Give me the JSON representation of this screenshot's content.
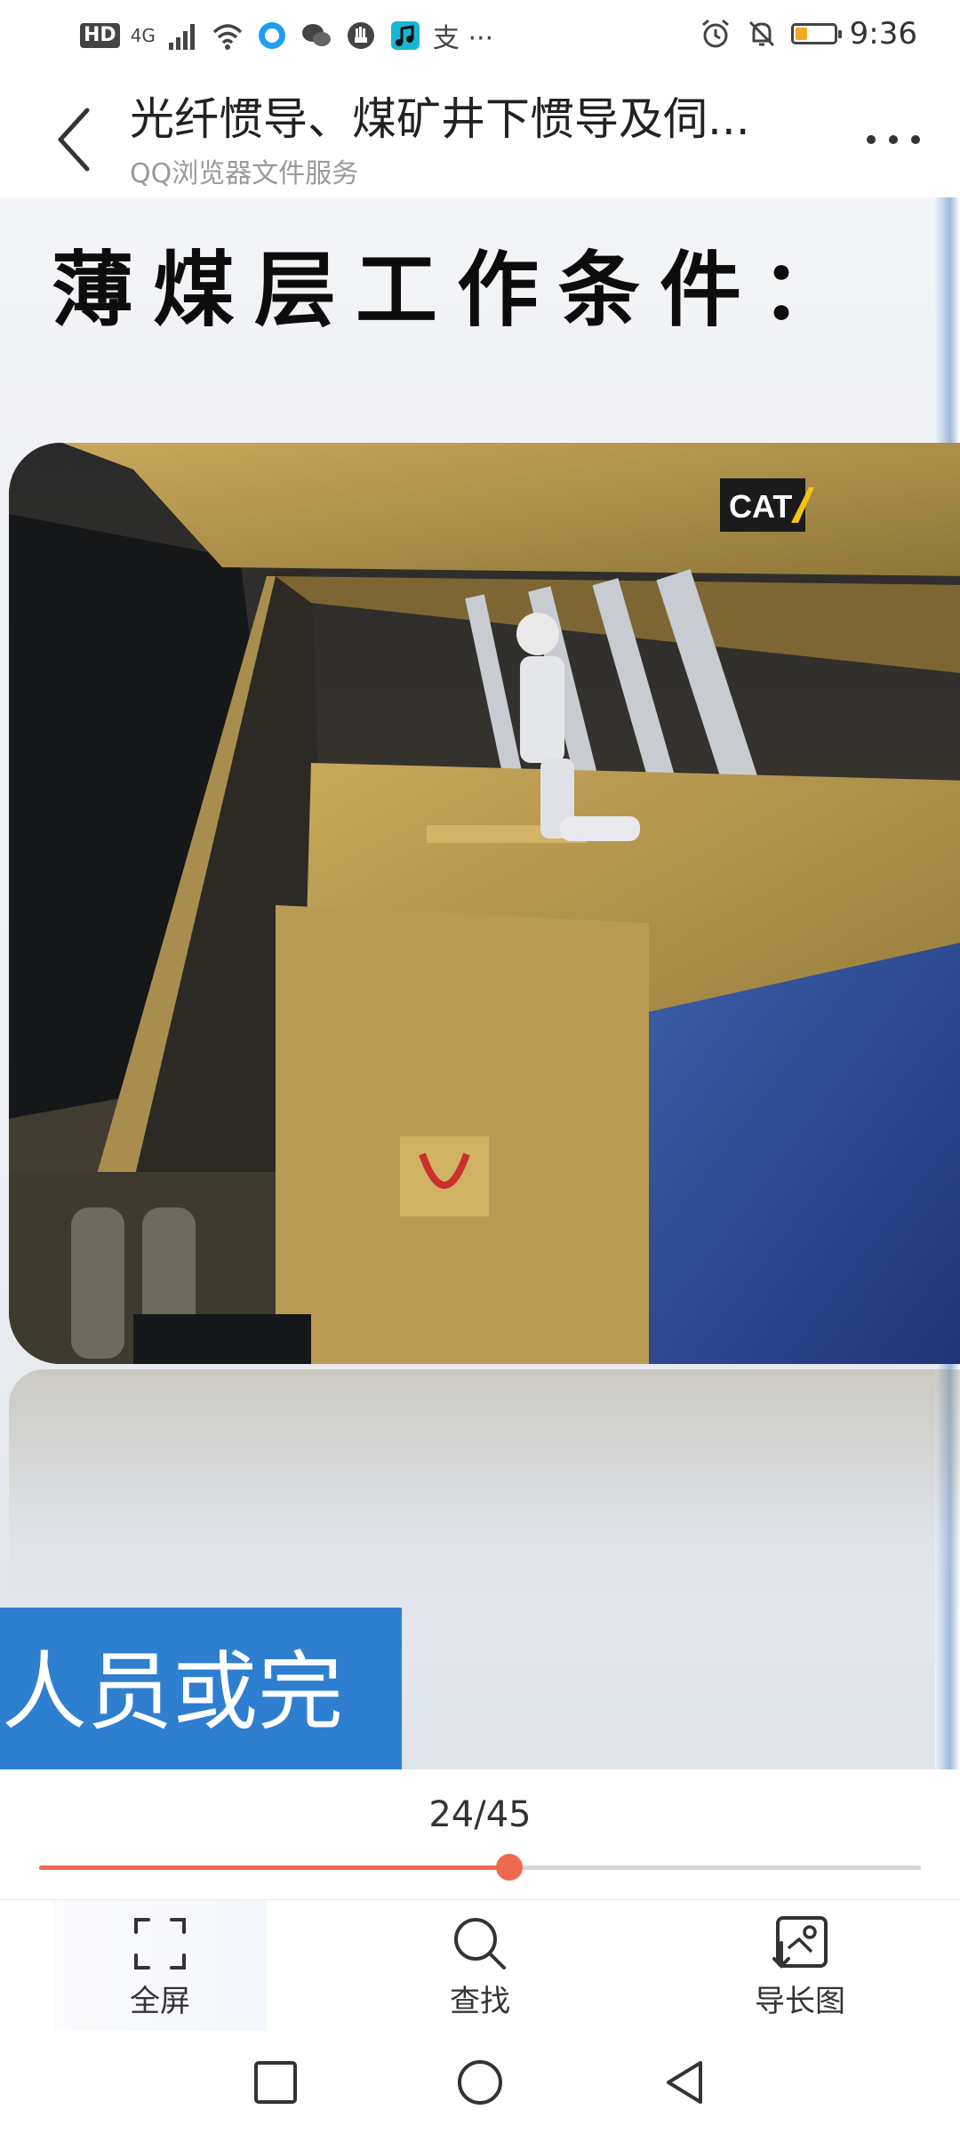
{
  "status_bar": {
    "left_badge": "HD",
    "network": "4G",
    "extra": "支 ···",
    "time": "9:36",
    "battery_level": 0.3,
    "icons": [
      "signal-icon",
      "wifi-icon",
      "qq-icon",
      "wechat-icon",
      "hand-icon",
      "music-app-icon",
      "alarm-icon",
      "mute-icon",
      "battery-icon"
    ]
  },
  "header": {
    "title": "光纤惯导、煤矿井下惯导及伺...",
    "subtitle": "QQ浏览器文件服务",
    "back_icon": "chevron-left-icon",
    "more_icon": "more-dots-icon"
  },
  "document": {
    "heading": "薄煤层工作条件：",
    "photo_logo": "CAT",
    "caption": "作人员或完"
  },
  "pager": {
    "page_label": "24/45",
    "current": 24,
    "total": 45,
    "accent": "#ee6a4e"
  },
  "toolbar": {
    "items": [
      {
        "label": "全屏",
        "icon": "fullscreen-icon"
      },
      {
        "label": "查找",
        "icon": "search-icon"
      },
      {
        "label": "导长图",
        "icon": "export-image-icon"
      }
    ]
  },
  "navbar": {
    "icons": [
      "recent-apps-icon",
      "home-icon",
      "back-icon"
    ]
  }
}
